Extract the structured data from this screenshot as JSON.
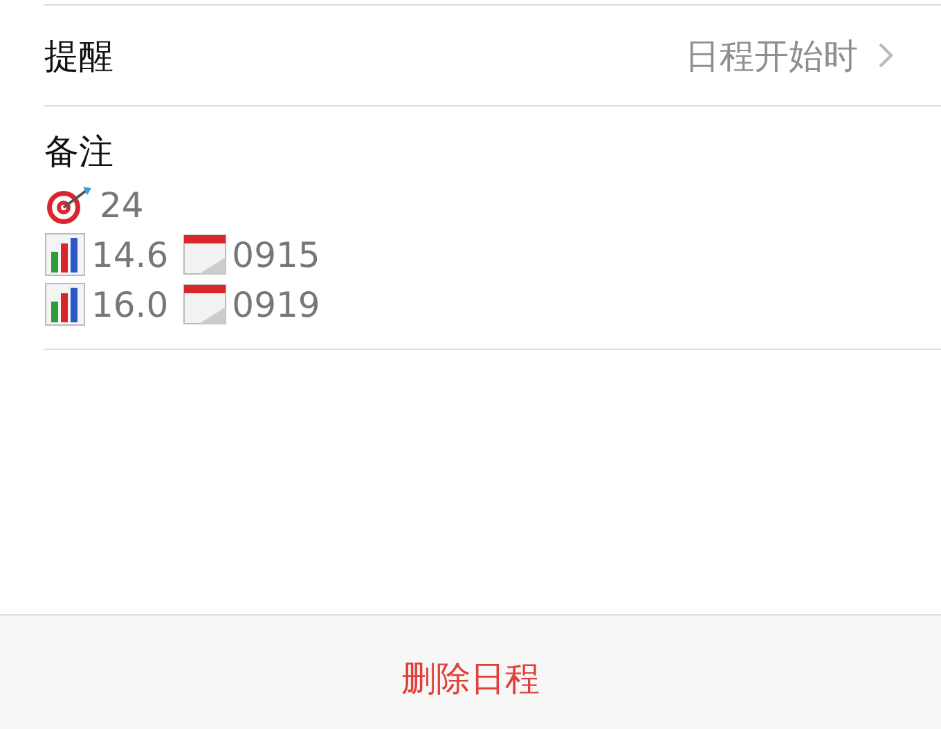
{
  "reminder": {
    "label": "提醒",
    "value": "日程开始时"
  },
  "notes": {
    "label": "备注",
    "lines": [
      {
        "items": [
          {
            "kind": "target",
            "text": "24"
          }
        ]
      },
      {
        "items": [
          {
            "kind": "chart",
            "text": "14.6"
          },
          {
            "kind": "calendar",
            "text": "0915"
          }
        ]
      },
      {
        "items": [
          {
            "kind": "chart",
            "text": "16.0"
          },
          {
            "kind": "calendar",
            "text": "0919"
          }
        ]
      }
    ]
  },
  "delete_button": "删除日程"
}
